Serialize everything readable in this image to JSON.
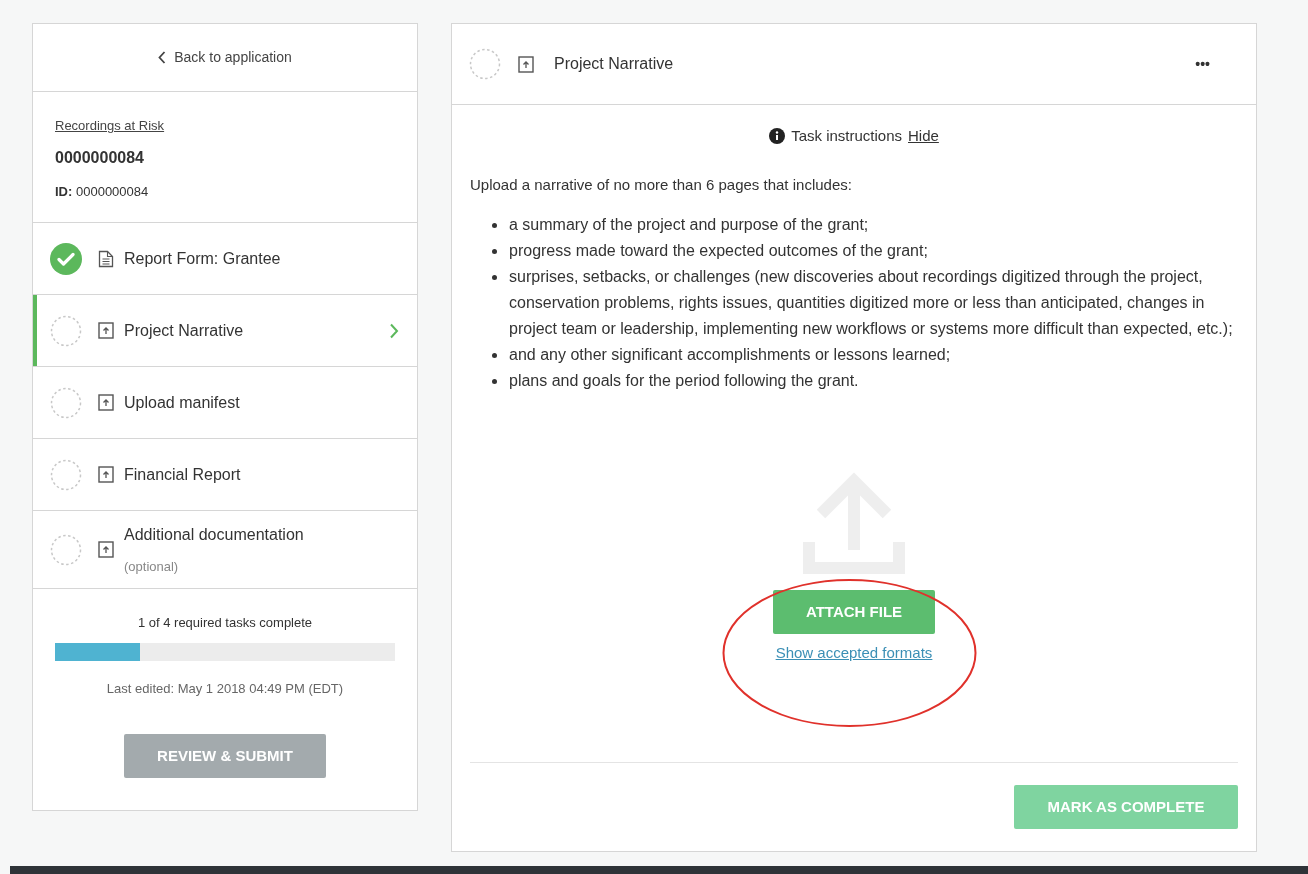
{
  "sidebar": {
    "back_link": "Back to application",
    "project_link": "Recordings at Risk",
    "project_number": "0000000084",
    "id_label": "ID:",
    "id_value": "0000000084",
    "tasks": [
      {
        "label": "Report Form: Grantee",
        "kind": "form",
        "complete": true,
        "selected": false
      },
      {
        "label": "Project Narrative",
        "kind": "upload",
        "complete": false,
        "selected": true
      },
      {
        "label": "Upload manifest",
        "kind": "upload",
        "complete": false,
        "selected": false
      },
      {
        "label": "Financial Report",
        "kind": "upload",
        "complete": false,
        "selected": false
      },
      {
        "label": "Additional documentation",
        "note": "(optional)",
        "kind": "upload",
        "complete": false,
        "selected": false
      }
    ],
    "progress_text": "1 of 4 required tasks complete",
    "progress": {
      "level": 0.25
    },
    "last_edited": "Last edited: May 1 2018 04:49 PM (EDT)",
    "submit_button": {
      "label": "REVIEW & SUBMIT",
      "disabled": true
    }
  },
  "task": {
    "title": "Project Narrative",
    "complete": false,
    "menu": "•••",
    "instructions_label": "Task instructions",
    "instructions_toggle": "Hide",
    "intro": "Upload a narrative of no more than 6 pages that includes:",
    "bullets": [
      "a summary of the project and purpose of the grant;",
      "progress made toward the expected outcomes of the grant;",
      "surprises, setbacks, or challenges (new discoveries about recordings digitized through the project, conservation problems, rights issues, quantities digitized more or less than anticipated, changes in project team or leadership, implementing new workflows or systems more difficult than expected, etc.);",
      "and any other significant accomplishments or lessons learned;",
      "plans and goals for the period following the grant."
    ],
    "attach_button": "ATTACH FILE",
    "formats_link": "Show accepted formats",
    "complete_button": {
      "label": "MARK AS COMPLETE",
      "disabled": true
    }
  }
}
